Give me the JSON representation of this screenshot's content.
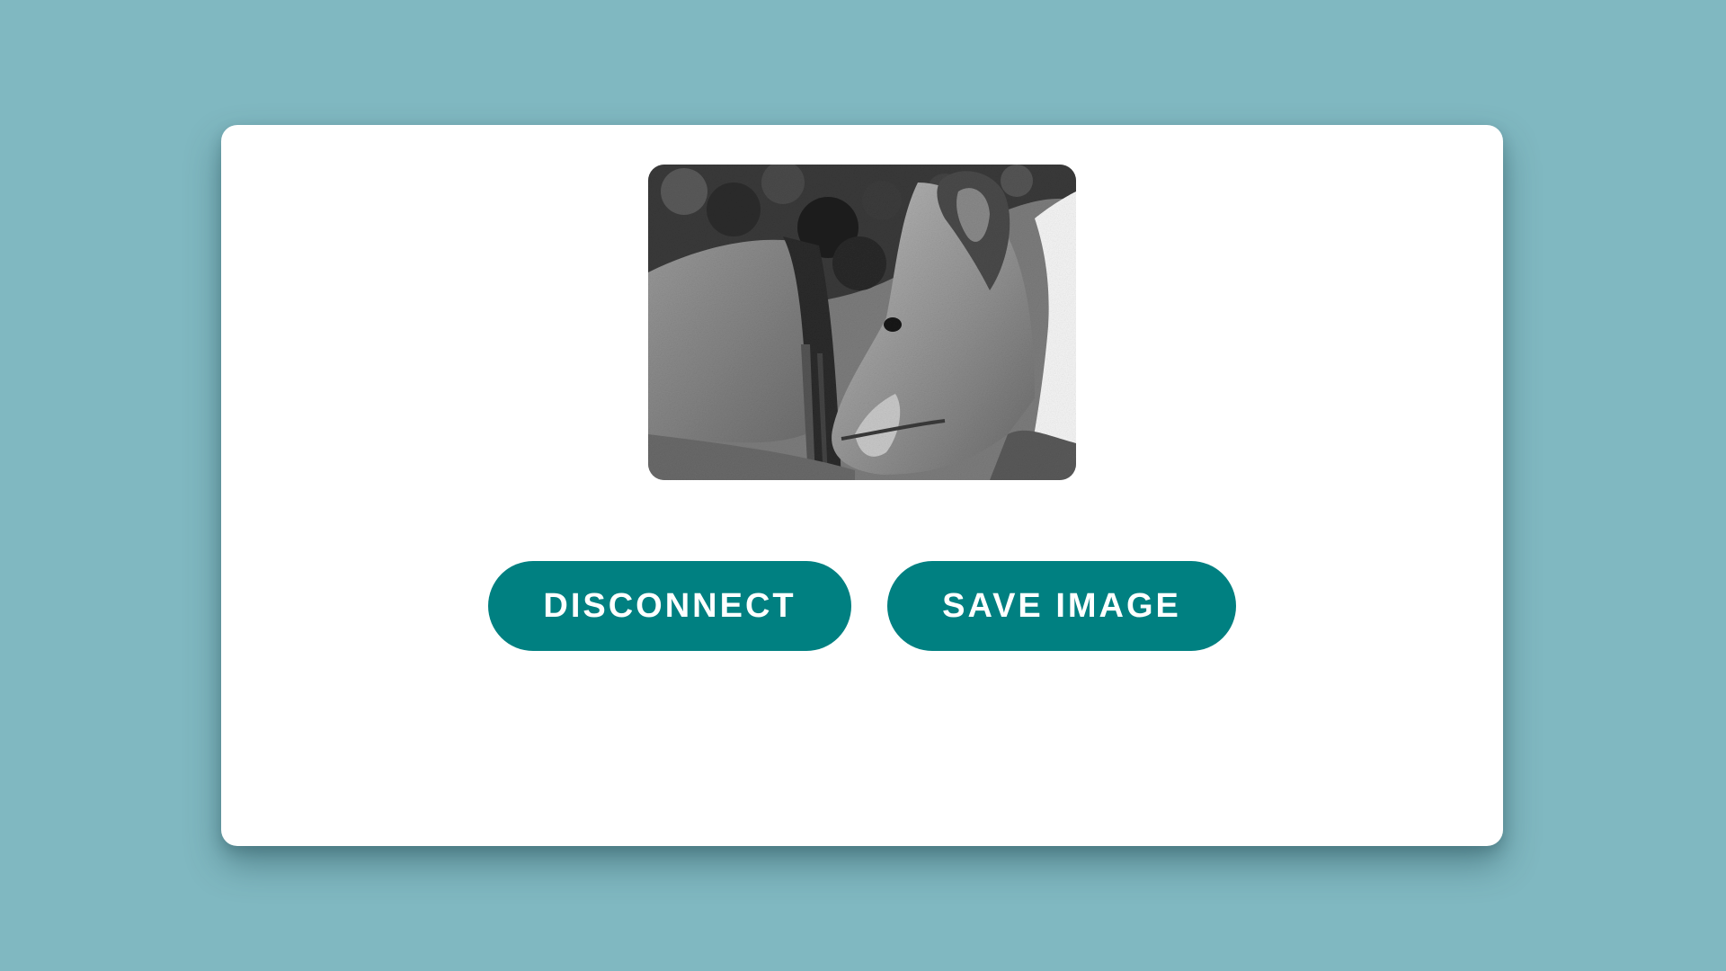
{
  "theme": {
    "background": "#80b8c1",
    "card": "#ffffff",
    "accent": "#008081",
    "button_text": "#ffffff"
  },
  "preview": {
    "description_icon": "captured-photo",
    "style": "grayscale"
  },
  "actions": {
    "disconnect_label": "DISCONNECT",
    "save_label": "SAVE IMAGE"
  }
}
